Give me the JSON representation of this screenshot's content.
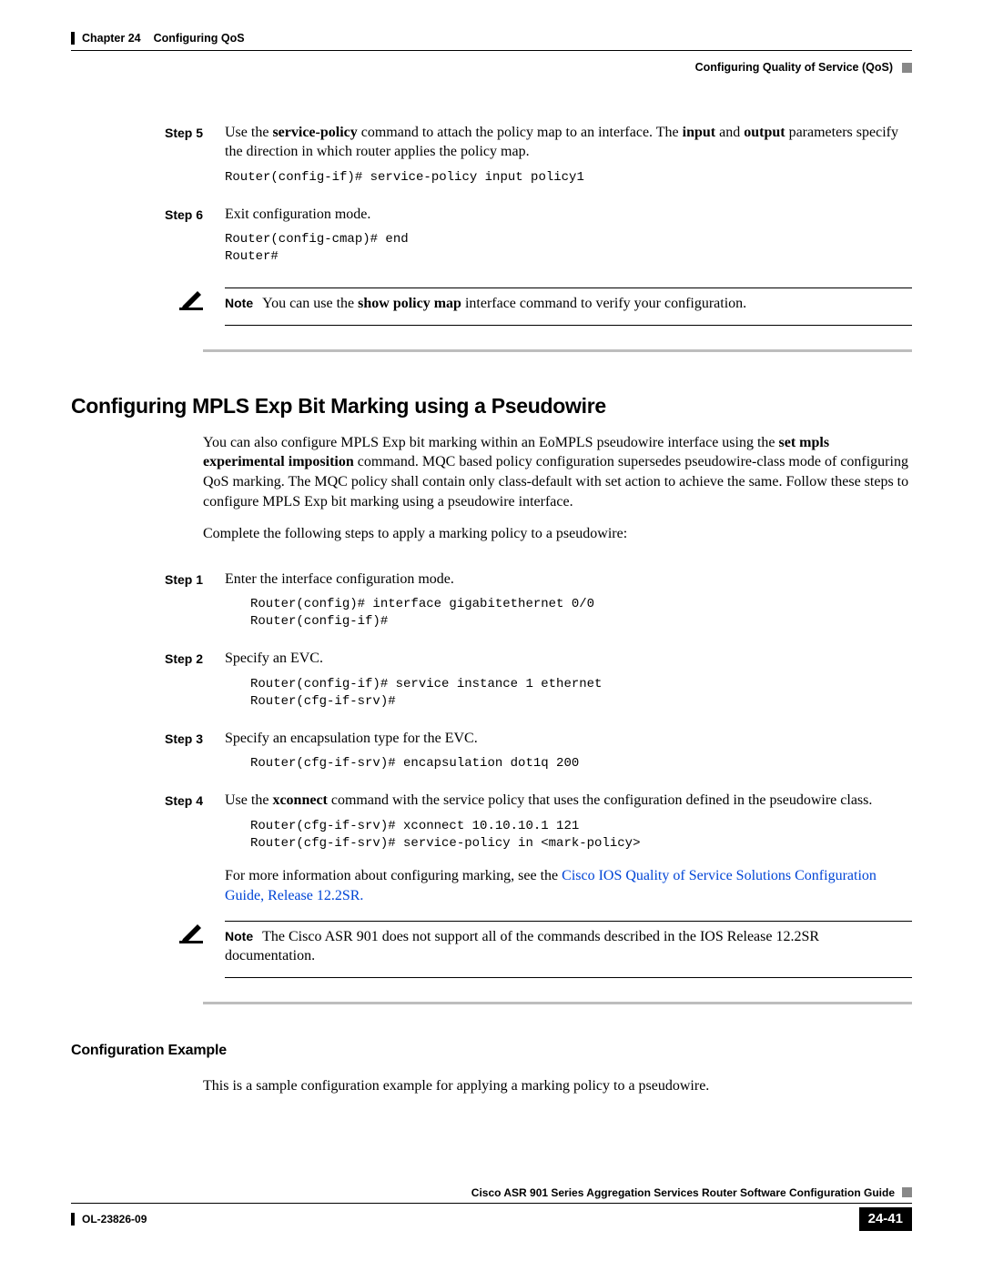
{
  "header": {
    "chapter_label": "Chapter 24",
    "chapter_title": "Configuring QoS",
    "section_title": "Configuring Quality of Service (QoS)"
  },
  "steps_a": {
    "s5": {
      "label": "Step 5",
      "text_pre": "Use the ",
      "cmd1": "service-policy",
      "text_mid1": " command to attach the policy map to an interface. The ",
      "cmd2": "input",
      "text_mid2": " and ",
      "cmd3": "output",
      "text_post": " parameters specify the direction in which router applies the policy map.",
      "code": "Router(config-if)# service-policy input policy1"
    },
    "s6": {
      "label": "Step 6",
      "text": "Exit configuration mode.",
      "code": "Router(config-cmap)# end\nRouter#"
    }
  },
  "note1": {
    "label": "Note",
    "pre": "You can use the ",
    "bold": "show policy map",
    "post": " interface command to verify your configuration."
  },
  "h2": "Configuring MPLS Exp Bit Marking using a Pseudowire",
  "intro": {
    "p1_pre": "You can also configure MPLS Exp bit marking within an EoMPLS pseudowire interface using the ",
    "p1_bold": "set mpls experimental imposition",
    "p1_post": " command. MQC based policy configuration supersedes pseudowire-class mode of configuring QoS marking. The MQC policy shall contain only class-default with set action to achieve the same. Follow these steps to configure MPLS Exp bit marking using a pseudowire interface.",
    "p2": "Complete the following steps to apply a marking policy to a pseudowire:"
  },
  "steps_b": {
    "s1": {
      "label": "Step 1",
      "text": "Enter the interface configuration mode.",
      "code": "Router(config)# interface gigabitethernet 0/0\nRouter(config-if)#"
    },
    "s2": {
      "label": "Step 2",
      "text": "Specify an EVC.",
      "code": "Router(config-if)# service instance 1 ethernet\nRouter(cfg-if-srv)#"
    },
    "s3": {
      "label": "Step 3",
      "text": "Specify an encapsulation type for the EVC.",
      "code": "Router(cfg-if-srv)# encapsulation dot1q 200"
    },
    "s4": {
      "label": "Step 4",
      "pre": "Use the ",
      "bold": "xconnect",
      "post": " command with the service policy that uses the configuration defined in the pseudowire class.",
      "code": "Router(cfg-if-srv)# xconnect 10.10.10.1 121\nRouter(cfg-if-srv)# service-policy in <mark-policy>",
      "after_pre": "For more information about configuring marking, see the ",
      "link": "Cisco IOS Quality of Service Solutions Configuration Guide, Release 12.2SR."
    }
  },
  "note2": {
    "label": "Note",
    "text": "The Cisco ASR 901 does not support all of the commands described in the IOS Release 12.2SR documentation."
  },
  "h3": "Configuration Example",
  "ex_intro": "This is a sample configuration example for applying a marking policy to a pseudowire.",
  "footer": {
    "title": "Cisco ASR 901 Series Aggregation Services Router Software Configuration Guide",
    "docnum": "OL-23826-09",
    "page": "24-41"
  }
}
